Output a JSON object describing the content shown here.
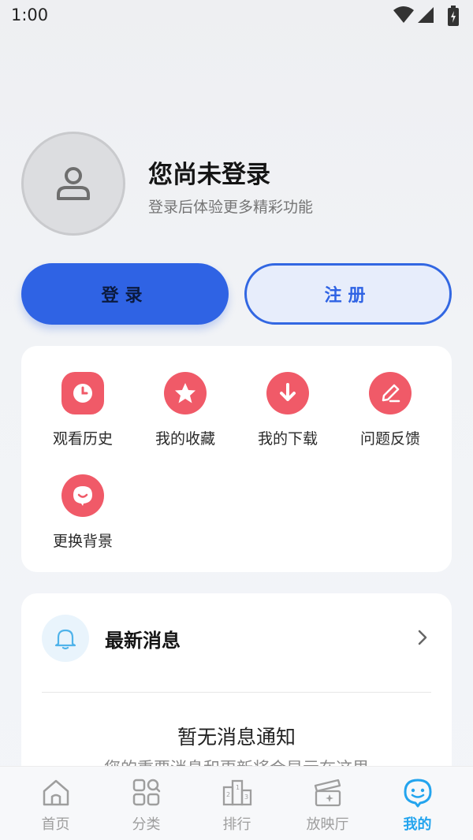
{
  "status_bar": {
    "time": "1:00",
    "icons": [
      "wifi-icon",
      "signal-icon",
      "battery-icon"
    ]
  },
  "profile": {
    "title": "您尚未登录",
    "subtitle": "登录后体验更多精彩功能",
    "avatar_icon": "user-icon"
  },
  "buttons": {
    "login": "登录",
    "register": "注册"
  },
  "menu": {
    "items": [
      {
        "label": "观看历史",
        "icon": "clock-icon"
      },
      {
        "label": "我的收藏",
        "icon": "star-icon"
      },
      {
        "label": "我的下载",
        "icon": "download-icon"
      },
      {
        "label": "问题反馈",
        "icon": "pencil-icon"
      },
      {
        "label": "更换背景",
        "icon": "chat-bubble-icon"
      }
    ]
  },
  "messages": {
    "title": "最新消息",
    "empty_title": "暂无消息通知",
    "empty_subtitle": "您的重要消息和更新将会显示在这里"
  },
  "tabbar": {
    "tabs": [
      {
        "label": "首页",
        "icon": "home-icon"
      },
      {
        "label": "分类",
        "icon": "category-icon"
      },
      {
        "label": "排行",
        "icon": "ranking-icon"
      },
      {
        "label": "放映厅",
        "icon": "clapper-icon"
      },
      {
        "label": "我的",
        "icon": "profile-face-icon",
        "active": true
      }
    ]
  },
  "colors": {
    "primary": "#2f63e4",
    "accent_red": "#f05a68",
    "tab_active": "#23a4ee",
    "tab_inactive": "#9e9e9e"
  }
}
